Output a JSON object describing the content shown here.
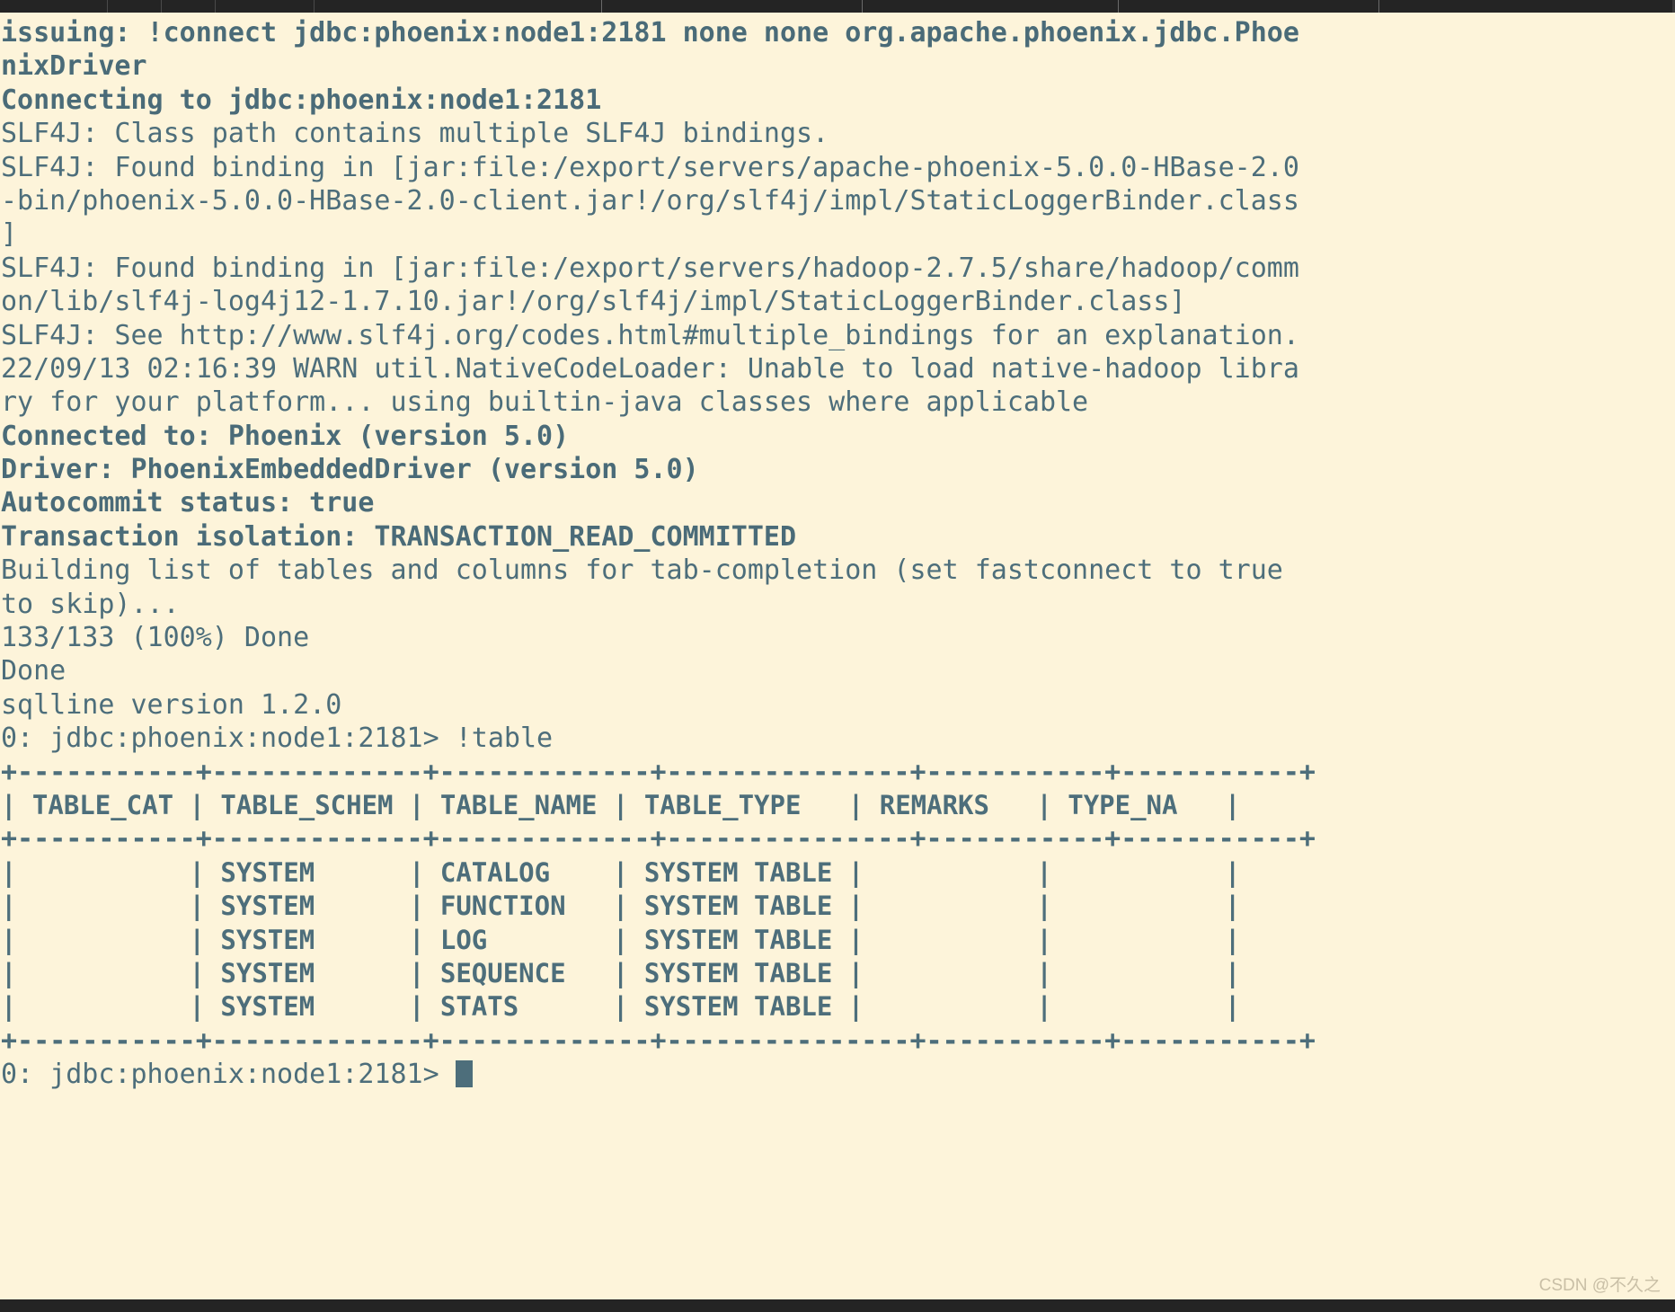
{
  "window": {
    "app": "terminal-emulator",
    "colors": {
      "background": "#fdf4da",
      "foreground": "#4d6e7b",
      "chrome": "#242424",
      "cursor": "#4d6e7b",
      "watermark": "#c9bfa6"
    }
  },
  "terminal": {
    "lines": [
      {
        "text": "issuing: !connect jdbc:phoenix:node1:2181 none none org.apache.phoenix.jdbc.Phoe",
        "bold": true
      },
      {
        "text": "nixDriver",
        "bold": true
      },
      {
        "text": "Connecting to jdbc:phoenix:node1:2181",
        "bold": true
      },
      {
        "text": "SLF4J: Class path contains multiple SLF4J bindings.",
        "bold": false
      },
      {
        "text": "SLF4J: Found binding in [jar:file:/export/servers/apache-phoenix-5.0.0-HBase-2.0",
        "bold": false
      },
      {
        "text": "-bin/phoenix-5.0.0-HBase-2.0-client.jar!/org/slf4j/impl/StaticLoggerBinder.class",
        "bold": false
      },
      {
        "text": "]",
        "bold": false
      },
      {
        "text": "SLF4J: Found binding in [jar:file:/export/servers/hadoop-2.7.5/share/hadoop/comm",
        "bold": false
      },
      {
        "text": "on/lib/slf4j-log4j12-1.7.10.jar!/org/slf4j/impl/StaticLoggerBinder.class]",
        "bold": false
      },
      {
        "text": "SLF4J: See http://www.slf4j.org/codes.html#multiple_bindings for an explanation.",
        "bold": false
      },
      {
        "text": "22/09/13 02:16:39 WARN util.NativeCodeLoader: Unable to load native-hadoop libra",
        "bold": false
      },
      {
        "text": "ry for your platform... using builtin-java classes where applicable",
        "bold": false
      },
      {
        "text": "Connected to: Phoenix (version 5.0)",
        "bold": true
      },
      {
        "text": "Driver: PhoenixEmbeddedDriver (version 5.0)",
        "bold": true
      },
      {
        "text": "Autocommit status: true",
        "bold": true
      },
      {
        "text": "Transaction isolation: TRANSACTION_READ_COMMITTED",
        "bold": true
      },
      {
        "text": "Building list of tables and columns for tab-completion (set fastconnect to true",
        "bold": false
      },
      {
        "text": "to skip)...",
        "bold": false
      },
      {
        "text": "133/133 (100%) Done",
        "bold": false
      },
      {
        "text": "Done",
        "bold": false
      },
      {
        "text": "sqlline version 1.2.0",
        "bold": false
      }
    ],
    "prompt_command": {
      "prompt": "0: jdbc:phoenix:node1:2181> ",
      "command": "!table"
    },
    "result_table": {
      "top_rule": "+-----------+-------------+-------------+---------------+-----------+-----------+",
      "header_rule": "+-----------+-------------+-------------+---------------+-----------+-----------+",
      "bottom_rule": "+-----------+-------------+-------------+---------------+-----------+-----------+",
      "columns": [
        "TABLE_CAT",
        "TABLE_SCHEM",
        "TABLE_NAME",
        "TABLE_TYPE",
        "REMARKS",
        "TYPE_NA"
      ],
      "header_line": "| TABLE_CAT | TABLE_SCHEM | TABLE_NAME | TABLE_TYPE   | REMARKS   | TYPE_NA   |",
      "rows": [
        {
          "cells": [
            "",
            "SYSTEM",
            "CATALOG",
            "SYSTEM TABLE",
            "",
            ""
          ],
          "line": "|           | SYSTEM      | CATALOG    | SYSTEM TABLE |           |           |"
        },
        {
          "cells": [
            "",
            "SYSTEM",
            "FUNCTION",
            "SYSTEM TABLE",
            "",
            ""
          ],
          "line": "|           | SYSTEM      | FUNCTION   | SYSTEM TABLE |           |           |"
        },
        {
          "cells": [
            "",
            "SYSTEM",
            "LOG",
            "SYSTEM TABLE",
            "",
            ""
          ],
          "line": "|           | SYSTEM      | LOG        | SYSTEM TABLE |           |           |"
        },
        {
          "cells": [
            "",
            "SYSTEM",
            "SEQUENCE",
            "SYSTEM TABLE",
            "",
            ""
          ],
          "line": "|           | SYSTEM      | SEQUENCE   | SYSTEM TABLE |           |           |"
        },
        {
          "cells": [
            "",
            "SYSTEM",
            "STATS",
            "SYSTEM TABLE",
            "",
            ""
          ],
          "line": "|           | SYSTEM      | STATS      | SYSTEM TABLE |           |           |"
        }
      ]
    },
    "final_prompt": "0: jdbc:phoenix:node1:2181> ",
    "cursor": "block-cursor"
  },
  "watermark": {
    "text": "CSDN @不久之"
  }
}
